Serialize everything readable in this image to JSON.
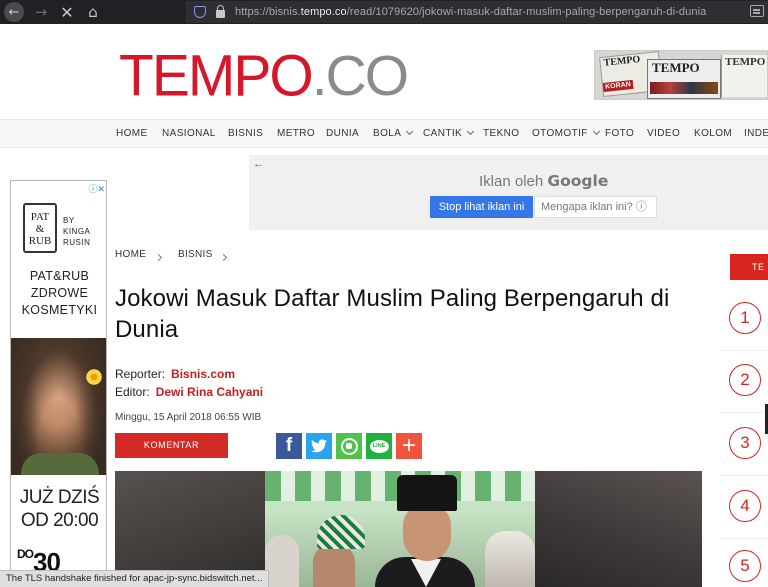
{
  "browser": {
    "url_prefix": "https://bisnis.",
    "url_domain": "tempo.co",
    "url_path": "/read/1079620/jokowi-masuk-daftar-muslim-paling-berpengaruh-di-dunia"
  },
  "header": {
    "logo_main": "TEMPO",
    "logo_suffix": ".CO",
    "ad_text_a": "TEMPO",
    "ad_text_b": "KORAN",
    "ad_text_c": "TEMPO",
    "ad_text_d": "TEMPO"
  },
  "nav": {
    "items": [
      {
        "label": "HOME"
      },
      {
        "label": "NASIONAL"
      },
      {
        "label": "BISNIS"
      },
      {
        "label": "METRO"
      },
      {
        "label": "DUNIA"
      },
      {
        "label": "BOLA"
      },
      {
        "label": "CANTIK"
      },
      {
        "label": "TEKNO"
      },
      {
        "label": "OTOMOTIF"
      },
      {
        "label": "FOTO"
      },
      {
        "label": "VIDEO"
      },
      {
        "label": "KOLOM"
      },
      {
        "label": "INDE"
      }
    ]
  },
  "google_ad": {
    "back_arrow": "←",
    "title_prefix": "Iklan oleh",
    "title_brand": "Google",
    "stop_label": "Stop lihat iklan ini",
    "why_label": "Mengapa iklan ini? ⓘ"
  },
  "side_ad": {
    "adchoice": "ⓘ✕",
    "logo_line1": "PAT",
    "logo_line2": "&",
    "logo_line3": "RUB",
    "by_line1": "BY",
    "by_line2": "KINGA",
    "by_line3": "RUSIN",
    "name_line1": "PAT&RUB",
    "name_line2": "ZDROWE",
    "name_line3": "KOSMETYKI",
    "cta_line1": "JUŻ DZIŚ",
    "cta_line2": "OD 20:00",
    "promo_prefix": "DO",
    "promo_value": "30"
  },
  "breadcrumb": {
    "home": "HOME",
    "section": "BISNIS"
  },
  "article": {
    "headline": "Jokowi Masuk Daftar Muslim Paling Berpengaruh di Dunia",
    "reporter_label": "Reporter:",
    "reporter_value": "Bisnis.com",
    "editor_label": "Editor:",
    "editor_value": "Dewi Rina Cahyani",
    "date": "Minggu, 15 April 2018 06:55 WIB",
    "komentar_label": "KOMENTAR"
  },
  "share": {
    "facebook": "f",
    "twitter": "🐦",
    "line": "LINE",
    "plus": "+"
  },
  "right_column": {
    "tab_label": "TE",
    "numbers": [
      "1",
      "2",
      "3",
      "4",
      "5"
    ]
  },
  "status": {
    "text": "The TLS handshake finished for apac-jp-sync.bidswitch.net..."
  },
  "colors": {
    "brand_red": "#d4182a",
    "link_red": "#c41e20",
    "facebook": "#3b5998",
    "twitter": "#2aa3ef",
    "whatsapp": "#4fc34b",
    "line": "#20b13e",
    "plus": "#f0543c",
    "google_blue": "#3576e9"
  }
}
